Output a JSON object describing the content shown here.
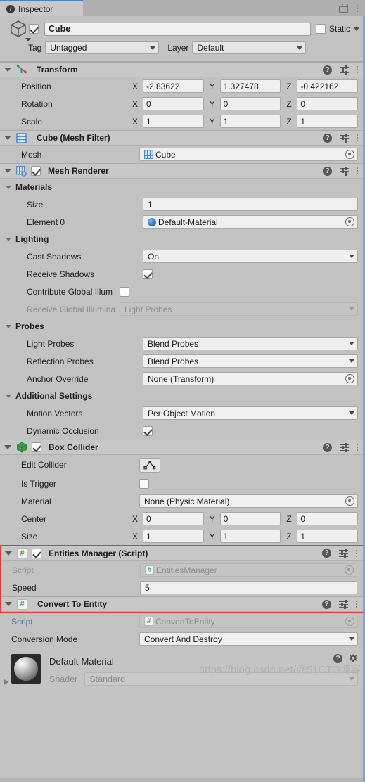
{
  "window": {
    "tab_label": "Inspector",
    "tab_icon": "info-icon",
    "lock_icon": "lock-icon",
    "menu_icon": "kebab-menu-icon"
  },
  "object_header": {
    "enabled": true,
    "name": "Cube",
    "static_label": "Static",
    "static_checked": false,
    "tag_label": "Tag",
    "tag_value": "Untagged",
    "layer_label": "Layer",
    "layer_value": "Default"
  },
  "components": [
    {
      "id": "transform",
      "title": "Transform",
      "icon": "transform-axis-icon",
      "has_checkbox": false,
      "rows": [
        {
          "label": "Position",
          "type": "vector3",
          "x": "-2.83622",
          "y": "1.327478",
          "z": "-0.422162"
        },
        {
          "label": "Rotation",
          "type": "vector3",
          "x": "0",
          "y": "0",
          "z": "0"
        },
        {
          "label": "Scale",
          "type": "vector3",
          "x": "1",
          "y": "1",
          "z": "1"
        }
      ]
    },
    {
      "id": "mesh-filter",
      "title": "Cube (Mesh Filter)",
      "icon": "mesh-filter-icon",
      "has_checkbox": false,
      "rows": [
        {
          "label": "Mesh",
          "type": "object",
          "value": "Cube",
          "icon": "mesh-icon"
        }
      ]
    },
    {
      "id": "mesh-renderer",
      "title": "Mesh Renderer",
      "icon": "mesh-renderer-icon",
      "has_checkbox": true,
      "checked": true,
      "groups": [
        {
          "name": "Materials",
          "rows": [
            {
              "label": "Size",
              "type": "text",
              "value": "1"
            },
            {
              "label": "Element 0",
              "type": "object",
              "value": "Default-Material",
              "icon": "material-icon"
            }
          ]
        },
        {
          "name": "Lighting",
          "rows": [
            {
              "label": "Cast Shadows",
              "type": "dropdown",
              "value": "On"
            },
            {
              "label": "Receive Shadows",
              "type": "checkbox",
              "checked": true
            },
            {
              "label": "Contribute Global Illum",
              "type": "checkbox",
              "checked": false
            },
            {
              "label": "Receive Global Illumina",
              "type": "dropdown",
              "value": "Light Probes",
              "disabled": true
            }
          ]
        },
        {
          "name": "Probes",
          "rows": [
            {
              "label": "Light Probes",
              "type": "dropdown",
              "value": "Blend Probes"
            },
            {
              "label": "Reflection Probes",
              "type": "dropdown",
              "value": "Blend Probes"
            },
            {
              "label": "Anchor Override",
              "type": "object",
              "value": "None (Transform)"
            }
          ]
        },
        {
          "name": "Additional Settings",
          "rows": [
            {
              "label": "Motion Vectors",
              "type": "dropdown",
              "value": "Per Object Motion"
            },
            {
              "label": "Dynamic Occlusion",
              "type": "checkbox",
              "checked": true
            }
          ]
        }
      ]
    },
    {
      "id": "box-collider",
      "title": "Box Collider",
      "icon": "box-collider-icon",
      "has_checkbox": true,
      "checked": true,
      "rows": [
        {
          "label": "Edit Collider",
          "type": "button",
          "icon": "edit-collider-icon"
        },
        {
          "label": "Is Trigger",
          "type": "checkbox",
          "checked": false
        },
        {
          "label": "Material",
          "type": "object",
          "value": "None (Physic Material)"
        },
        {
          "label": "Center",
          "type": "vector3",
          "x": "0",
          "y": "0",
          "z": "0"
        },
        {
          "label": "Size",
          "type": "vector3",
          "x": "1",
          "y": "1",
          "z": "1"
        }
      ]
    },
    {
      "id": "entities-manager",
      "title": "Entities Manager (Script)",
      "icon": "script-icon",
      "has_checkbox": true,
      "checked": true,
      "highlighted": true,
      "rows": [
        {
          "label": "Script",
          "type": "object",
          "value": "EntitiesManager",
          "icon": "script-icon",
          "disabled": true
        },
        {
          "label": "Speed",
          "type": "text",
          "value": "5"
        }
      ]
    },
    {
      "id": "convert-to-entity",
      "title": "Convert To Entity",
      "icon": "script-icon",
      "has_checkbox": false,
      "highlighted": true,
      "rows": [
        {
          "label": "Script",
          "type": "object",
          "value": "ConvertToEntity",
          "icon": "script-icon",
          "disabled": true,
          "link": true
        },
        {
          "label": "Conversion Mode",
          "type": "dropdown",
          "value": "Convert And Destroy"
        }
      ]
    }
  ],
  "material_preview": {
    "name": "Default-Material",
    "shader_label": "Shader",
    "shader_value": "Standard",
    "help_icon": "help-icon",
    "gear_icon": "gear-icon"
  },
  "watermark": "https://blog.csdn.net/@51CTO博客",
  "header_icons": {
    "help": "?",
    "preset": "preset-icon",
    "menu": "kebab-menu-icon"
  },
  "colors": {
    "panel_bg": "#c2c2c2",
    "header_bg": "#c7c7c7",
    "field_bg": "#efefef",
    "accent_tab": "#4d7fc4",
    "highlight_border": "#e03b3b",
    "link_text": "#4a6fa5",
    "script_green": "#3f9a46"
  }
}
